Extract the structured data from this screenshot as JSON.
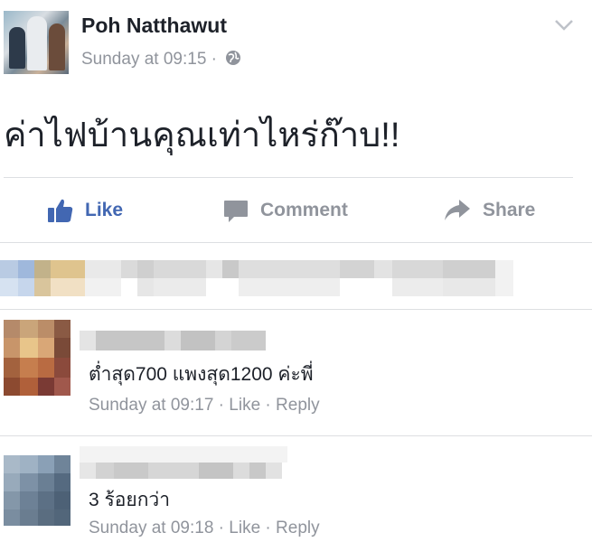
{
  "post": {
    "author": "Poh Natthawut",
    "timestamp": "Sunday at 09:15",
    "separator": " · ",
    "privacy_icon": "globe-icon",
    "text": "ค่าไฟบ้านคุณเท่าไหร่ก๊าบ!!"
  },
  "actions": {
    "like_label": "Like",
    "comment_label": "Comment",
    "share_label": "Share"
  },
  "comments": [
    {
      "text": "ต่ำสุด700 แพงสุด1200 ค่ะพี่",
      "time": "Sunday at 09:17",
      "like_label": "Like",
      "reply_label": "Reply",
      "sep": " · "
    },
    {
      "text": "3 ร้อยกว่า",
      "time": "Sunday at 09:18",
      "like_label": "Like",
      "reply_label": "Reply",
      "sep": " · "
    }
  ],
  "colors": {
    "accent_blue": "#4267b2",
    "muted_grey": "#90949c",
    "text": "#1d2129",
    "divider": "#dddfe2"
  }
}
